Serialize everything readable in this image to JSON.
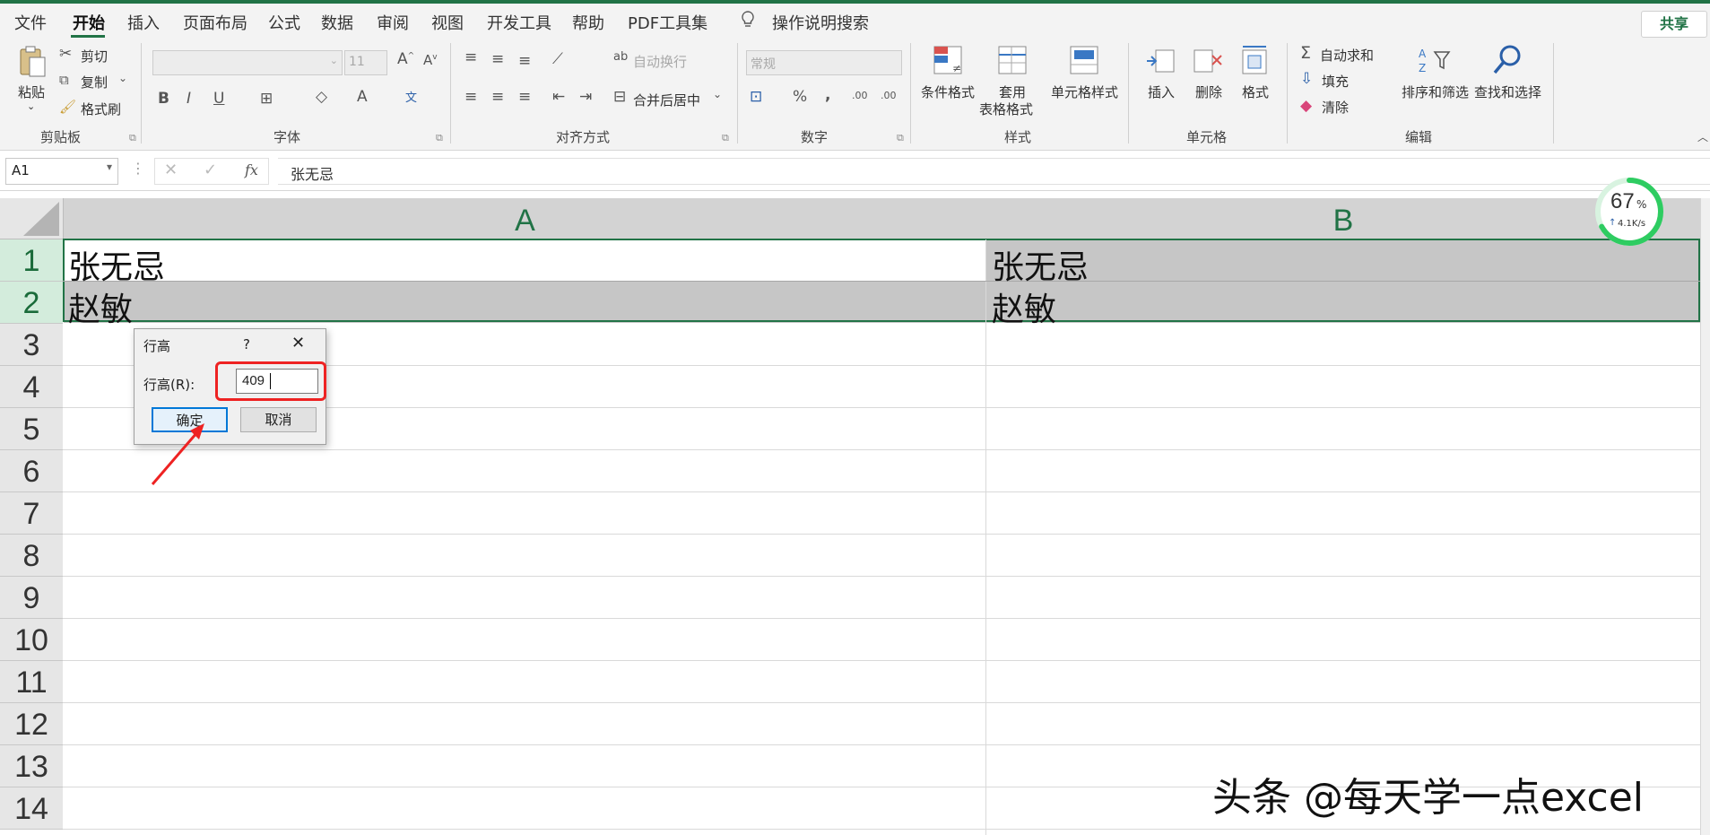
{
  "menu": {
    "tabs": [
      "文件",
      "开始",
      "插入",
      "页面布局",
      "公式",
      "数据",
      "审阅",
      "视图",
      "开发工具",
      "帮助",
      "PDF工具集"
    ],
    "active_tab": "开始",
    "search": "操作说明搜索",
    "share": "共享"
  },
  "ribbon": {
    "clipboard": {
      "paste": "粘贴",
      "cut": "剪切",
      "copy": "复制",
      "format_painter": "格式刷",
      "label": "剪贴板"
    },
    "font": {
      "size": "11",
      "bold": "B",
      "italic": "I",
      "underline": "U",
      "label": "字体"
    },
    "alignment": {
      "wrap": "自动换行",
      "merge": "合并后居中",
      "label": "对齐方式"
    },
    "number": {
      "format": "常规",
      "percent": "%",
      "comma": ",",
      "label": "数字"
    },
    "styles": {
      "conditional": "条件格式",
      "table_line1": "套用",
      "table_line2": "表格格式",
      "cell_styles": "单元格样式",
      "label": "样式"
    },
    "cells": {
      "insert": "插入",
      "delete": "删除",
      "format": "格式",
      "label": "单元格"
    },
    "editing": {
      "autosum": "自动求和",
      "fill": "填充",
      "clear": "清除",
      "sort": "排序和筛选",
      "find": "查找和选择",
      "label": "编辑"
    }
  },
  "formula_bar": {
    "name_box": "A1",
    "fx": "fx",
    "content": "张无忌"
  },
  "sheet": {
    "columns": [
      "A",
      "B"
    ],
    "rows": [
      "1",
      "2",
      "3",
      "4",
      "5",
      "6",
      "7",
      "8",
      "9",
      "10",
      "11",
      "12",
      "13",
      "14"
    ],
    "cells": {
      "A1": "张无忌",
      "B1": "张无忌",
      "A2": "赵敏",
      "B2": "赵敏"
    }
  },
  "dialog": {
    "title": "行高",
    "help": "?",
    "field_label": "行高(R):",
    "value": "409",
    "ok": "确定",
    "cancel": "取消"
  },
  "network_widget": {
    "percent": "67",
    "unit": "%",
    "speed": "4.1K/s",
    "value": 0.67
  },
  "watermark": "头条 @每天学一点excel",
  "colors": {
    "accent": "#217346",
    "highlight": "#ee2222",
    "selected_fill": "#c6c6c6"
  }
}
